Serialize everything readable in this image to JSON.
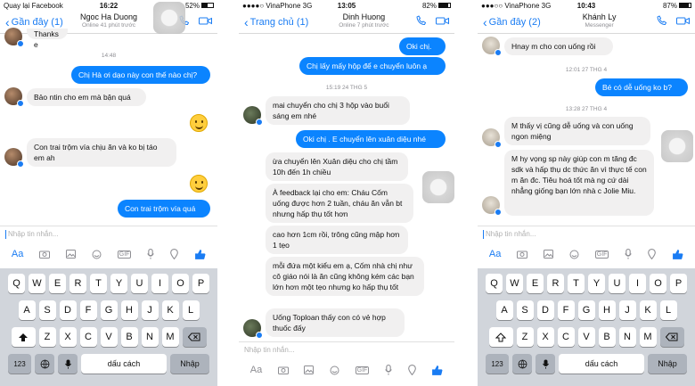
{
  "colors": {
    "accent": "#1a7cf3",
    "bubble_out": "#0b84ff",
    "bubble_in": "#f1f0f0",
    "keyboard_bg": "#d1d5db"
  },
  "keyboard": {
    "row1": [
      "Q",
      "W",
      "E",
      "R",
      "T",
      "Y",
      "U",
      "I",
      "O",
      "P"
    ],
    "row2": [
      "A",
      "S",
      "D",
      "F",
      "G",
      "H",
      "J",
      "K",
      "L"
    ],
    "row3": [
      "Z",
      "X",
      "C",
      "V",
      "B",
      "N",
      "M"
    ],
    "num": "123",
    "space": "dấu cách",
    "return": "Nhập"
  },
  "composer": {
    "placeholder": "Nhập tin nhắn...",
    "aa": "Aa",
    "gif": "GIF"
  },
  "phone1": {
    "status_left": "Quay lại Facebook",
    "time": "16:22",
    "battery": "52%",
    "back": "Gần đây (1)",
    "name": "Ngoc Ha Duong",
    "sub": "Online 41 phút trước",
    "ts1": "14:48",
    "m_top": "Thanks e",
    "m_out1": "Chị Hà ơi dạo này con thế nào chị?",
    "m_in1": "Bảo ntin cho em mà bận quá",
    "m_in2": "Con trai trộm vía chịu ăn và ko bị táo em ah",
    "m_out2": "Con trai trộm vía quá"
  },
  "phone2": {
    "carrier": "VinaPhone",
    "net": "3G",
    "time": "13:05",
    "battery": "82%",
    "back": "Trang chủ (1)",
    "name": "Dinh Huong",
    "sub": "Online 7 phút trước",
    "m_out1": "Oki chị.",
    "m_out2": "Chị lấy mấy hộp để e chuyển luôn ạ",
    "ts1": "15:19 24 THG 5",
    "m_in1": "mai chuyển cho chị 3 hộp vào buổi sáng em nhé",
    "m_out3": "Oki chị . E chuyển lên xuân diệu nhé",
    "m_in2": "ừa chuyển lên Xuân diệu cho chị tầm 10h đến 1h chiều",
    "m_in3": "À feedback lại cho em: Cháu Cốm uống được hơn 2 tuần, cháu ăn vẫn bt nhưng hấp thụ tốt hơn",
    "m_in4": "cao hơn 1cm rồi, trông cũng mập hơn 1 tẹo",
    "m_in5": "mỗi đứa một kiểu em ạ, Cốm nhà chị như cô giáo nói là ăn cũng không kém các bạn lớn hơn một tẹo nhưng ko hấp thụ tốt",
    "m_in6": "Uống Toploan thấy con có vẻ hợp thuốc đấy"
  },
  "phone3": {
    "carrier": "VinaPhone",
    "net": "3G",
    "time": "10:43",
    "battery": "87%",
    "back": "Gần đây (2)",
    "name": "Khánh Ly",
    "sub": "Messenger",
    "m_in1": "Hnay m cho con uống rồi",
    "ts1": "12:01 27 THG 4",
    "m_out1": "Bé có dễ uống ko b?",
    "ts2": "13:28 27 THG 4",
    "m_in2": "M thấy vị cũng dễ uống và con uống ngon miệng",
    "m_in3": "M hy vọng sp này giúp con m tăng đc sdk và hấp thụ dc thức ăn vì thực tế con m ăn đc. Tiêu hoá tốt mà ng cứ dài nhẳng giống bạn lớn nhà c Jolie Miu."
  }
}
